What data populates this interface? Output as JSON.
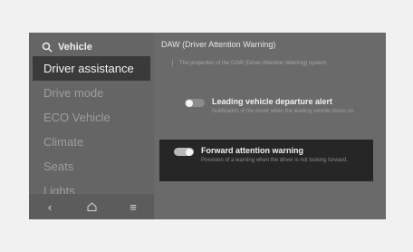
{
  "sidebar": {
    "search_label": "Vehicle",
    "items": [
      {
        "label": "Driver assistance"
      },
      {
        "label": "Drive mode"
      },
      {
        "label": "ECO Vehicle"
      },
      {
        "label": "Climate"
      },
      {
        "label": "Seats"
      },
      {
        "label": "Lights"
      }
    ],
    "bottom_icons": [
      "back-icon",
      "home-icon",
      "menu-icon"
    ]
  },
  "panel": {
    "title": "DAW (Driver Attention Warning)",
    "description": "The properties of the DAW (Driver Attention Warning) system.",
    "options": [
      {
        "label": "Leading vehicle departure alert",
        "description": "Notification of the driver when the leading vehicle drives on.",
        "enabled": false
      },
      {
        "label": "Forward attention warning",
        "description": "Provision of a warning when the driver is not looking forward.",
        "enabled": true
      }
    ]
  }
}
